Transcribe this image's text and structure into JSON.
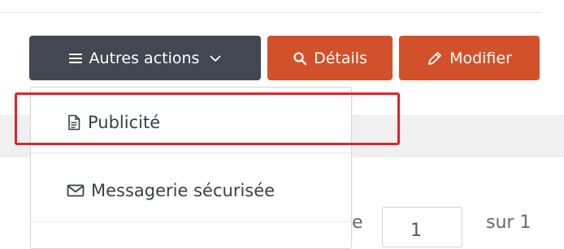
{
  "toolbar": {
    "actions_label": "Autres actions",
    "details_label": "Détails",
    "modifier_label": "Modifier",
    "icons": {
      "actions": "hamburger-menu-icon",
      "actions_chevron": "chevron-down-icon",
      "details": "search-icon",
      "modifier": "pencil-icon"
    }
  },
  "dropdown": {
    "items": [
      {
        "label": "Publicité",
        "icon": "document-icon"
      },
      {
        "label": "Messagerie sécurisée",
        "icon": "envelope-icon"
      }
    ]
  },
  "pagination": {
    "partial_label": "e",
    "current_page": "1",
    "total_label": "sur 1"
  },
  "colors": {
    "actions_button": "#424751",
    "primary_button": "#d2512a",
    "highlight": "#e0232c",
    "text": "#3a3f47"
  }
}
